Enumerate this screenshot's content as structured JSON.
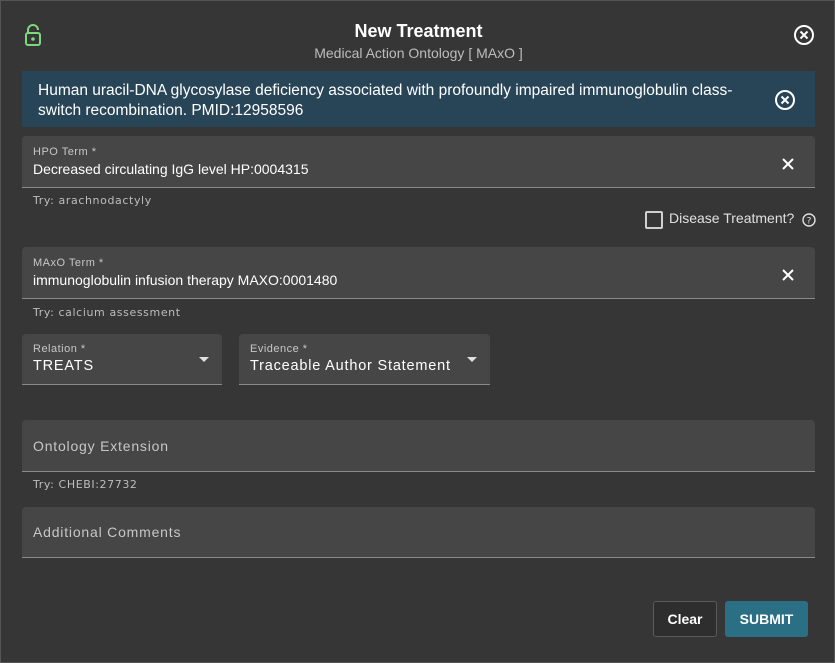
{
  "dialog": {
    "title": "New Treatment",
    "subtitle": "Medical Action Ontology [ MAxO ]"
  },
  "banner": {
    "text": "Human uracil-DNA glycosylase deficiency associated with profoundly impaired immunoglobulin class-switch recombination. PMID:12958596"
  },
  "hpo": {
    "label": "HPO Term *",
    "value": "Decreased circulating IgG level HP:0004315",
    "hint": "Try: arachnodactyly"
  },
  "disease_treatment": {
    "label": "Disease Treatment?",
    "checked": false
  },
  "maxo": {
    "label": "MAxO Term *",
    "value": "immunoglobulin infusion therapy MAXO:0001480",
    "hint": "Try: calcium assessment"
  },
  "relation": {
    "label": "Relation *",
    "value": "TREATS"
  },
  "evidence": {
    "label": "Evidence *",
    "value": "Traceable Author Statement"
  },
  "extension": {
    "placeholder": "Ontology Extension",
    "hint": "Try: CHEBI:27732"
  },
  "comments": {
    "placeholder": "Additional Comments"
  },
  "buttons": {
    "clear": "Clear",
    "submit": "SUBMIT"
  },
  "colors": {
    "lock_icon": "#7dd87d",
    "banner_bg": "#284558",
    "submit_bg": "#2b6f84",
    "field_bg": "#464646"
  },
  "icons": {
    "lock": "lock-open-icon",
    "close": "close-circle-icon",
    "clear": "close-icon",
    "help": "help-circle-icon",
    "dropdown": "caret-down-icon"
  }
}
